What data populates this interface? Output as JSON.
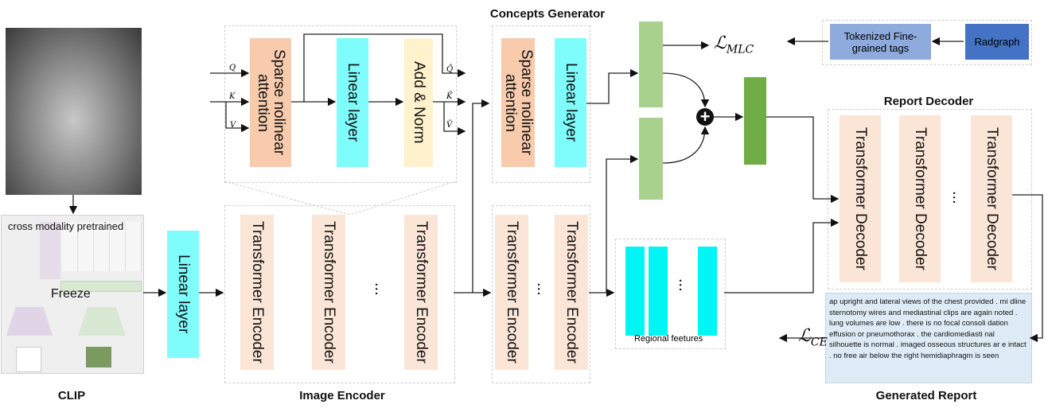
{
  "labels": {
    "clip": "CLIP",
    "image_encoder": "Image  Encoder",
    "concepts_generator": "Concepts Generator",
    "report_decoder": "Report Decoder",
    "generated_report": "Generated Report",
    "regional_features": "Regional feetures"
  },
  "clip": {
    "caption": "cross modality pretrained",
    "freeze": "Freeze"
  },
  "blocks": {
    "linear_layer": "Linear layer",
    "transformer_encoder": "Transformer Encoder",
    "sparse_attention": "Sparse nolinear attention",
    "add_norm": "Add & Norm",
    "transformer_decoder": "Transformer Decoder",
    "ellipsis": "..."
  },
  "symbols": {
    "q": "Q",
    "k": "K",
    "v": "V",
    "q_tilde": "Q̃",
    "k_tilde": "K̃",
    "v_tilde": "Ṽ",
    "plus": "+"
  },
  "losses": {
    "mlc": "ℒ",
    "mlc_sub": "MLC",
    "ce": "ℒ",
    "ce_sub": "CE"
  },
  "tags": {
    "tokenized": "Tokenized Fine-grained tags",
    "radgraph": "Radgraph"
  },
  "report_text": "ap upright and lateral views of the chest provided . mi dline sternotomy wires and mediastinal clips are again noted . lung volumes are low . there is no focal consoli dation effusion or pneumothorax . the cardiomediasti nal silhouette is normal . imaged osseous structures ar e intact . no free air below the right hemidiaphragm is seen",
  "colors": {
    "encoder": "#fbe5d6",
    "linear": "#7ffcfc",
    "sparse": "#f7cbac",
    "addnorm": "#fff2cc",
    "light_green": "#a9d18e",
    "dark_green": "#70ad47",
    "tokenized": "#8faadc",
    "radgraph": "#4472c4",
    "report_bg": "#deebf7"
  }
}
